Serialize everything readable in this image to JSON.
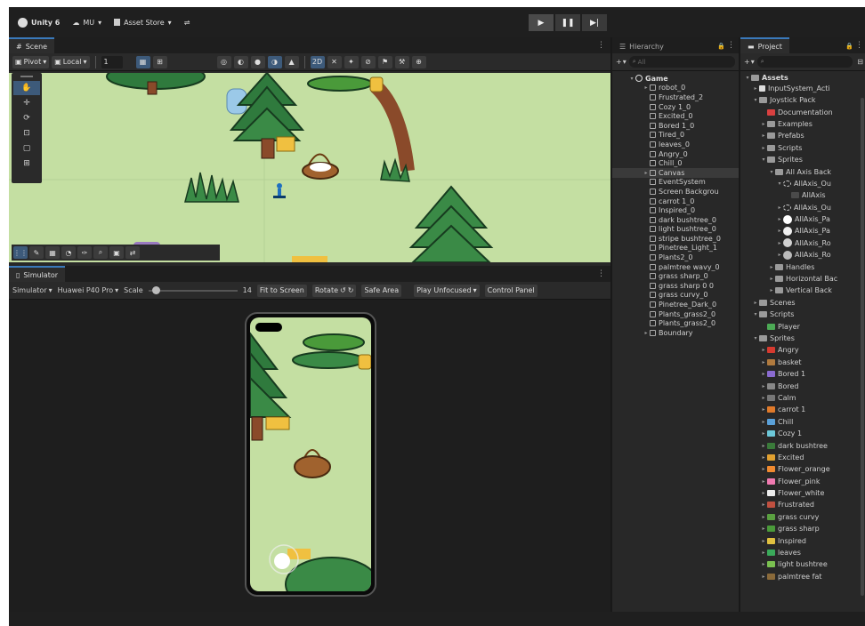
{
  "toolbar": {
    "account": "Unity 6",
    "account_icon": "unity-logo-icon",
    "mu": "MU",
    "asset_store": "Asset Store",
    "play_icon": "play-icon",
    "pause_icon": "pause-icon",
    "step_icon": "step-icon"
  },
  "scene": {
    "tab": "Scene",
    "pivot": "Pivot",
    "local": "Local",
    "snap_value": "1"
  },
  "simulator": {
    "tab": "Simulator",
    "mode": "Simulator",
    "device": "Huawei P40 Pro",
    "scale_label": "Scale",
    "scale_value": "14",
    "fit": "Fit to Screen",
    "rotate": "Rotate",
    "safe_area": "Safe Area",
    "play_mode": "Play Unfocused",
    "control_panel": "Control Panel"
  },
  "hierarchy": {
    "tab": "Hierarchy",
    "search_placeholder": "All",
    "root": "Game",
    "items": [
      {
        "label": "robot_0",
        "arrow": "▸",
        "sel": false
      },
      {
        "label": "Frustrated_2",
        "arrow": "",
        "sel": false
      },
      {
        "label": "Cozy 1_0",
        "arrow": "",
        "sel": false
      },
      {
        "label": "Excited_0",
        "arrow": "",
        "sel": false
      },
      {
        "label": "Bored 1_0",
        "arrow": "",
        "sel": false
      },
      {
        "label": "Tired_0",
        "arrow": "",
        "sel": false
      },
      {
        "label": "leaves_0",
        "arrow": "",
        "sel": false
      },
      {
        "label": "Angry_0",
        "arrow": "",
        "sel": false
      },
      {
        "label": "Chill_0",
        "arrow": "",
        "sel": false
      },
      {
        "label": "Canvas",
        "arrow": "▸",
        "sel": true
      },
      {
        "label": "EventSystem",
        "arrow": "",
        "sel": false
      },
      {
        "label": "Screen Backgrou",
        "arrow": "",
        "sel": false
      },
      {
        "label": "carrot 1_0",
        "arrow": "",
        "sel": false
      },
      {
        "label": "Inspired_0",
        "arrow": "",
        "sel": false
      },
      {
        "label": "dark bushtree_0",
        "arrow": "",
        "sel": false
      },
      {
        "label": "light bushtree_0",
        "arrow": "",
        "sel": false
      },
      {
        "label": "stripe bushtree_0",
        "arrow": "",
        "sel": false
      },
      {
        "label": "Pinetree_Light_1",
        "arrow": "",
        "sel": false
      },
      {
        "label": "Plants2_0",
        "arrow": "",
        "sel": false
      },
      {
        "label": "palmtree wavy_0",
        "arrow": "",
        "sel": false
      },
      {
        "label": "grass sharp_0",
        "arrow": "",
        "sel": false
      },
      {
        "label": "grass sharp 0 0",
        "arrow": "",
        "sel": false
      },
      {
        "label": "grass curvy_0",
        "arrow": "",
        "sel": false
      },
      {
        "label": "Pinetree_Dark_0",
        "arrow": "",
        "sel": false
      },
      {
        "label": "Plants_grass2_0",
        "arrow": "",
        "sel": false
      },
      {
        "label": "Plants_grass2_0",
        "arrow": "",
        "sel": false
      },
      {
        "label": "Boundary",
        "arrow": "▸",
        "sel": false
      }
    ]
  },
  "project": {
    "tab": "Project",
    "root": "Assets",
    "items": [
      {
        "label": "InputSystem_Acti",
        "d": 1,
        "arrow": "▸",
        "kind": "file",
        "color": "#ddd"
      },
      {
        "label": "Joystick Pack",
        "d": 1,
        "arrow": "▾",
        "kind": "folder",
        "color": "#9a9a9a"
      },
      {
        "label": "Documentation",
        "d": 2,
        "arrow": "",
        "kind": "swatch",
        "color": "#d94040"
      },
      {
        "label": "Examples",
        "d": 2,
        "arrow": "▸",
        "kind": "folder",
        "color": "#9a9a9a"
      },
      {
        "label": "Prefabs",
        "d": 2,
        "arrow": "▸",
        "kind": "folder",
        "color": "#9a9a9a"
      },
      {
        "label": "Scripts",
        "d": 2,
        "arrow": "▸",
        "kind": "folder",
        "color": "#9a9a9a"
      },
      {
        "label": "Sprites",
        "d": 2,
        "arrow": "▾",
        "kind": "folder",
        "color": "#9a9a9a"
      },
      {
        "label": "All Axis Back",
        "d": 3,
        "arrow": "▾",
        "kind": "folder",
        "color": "#9a9a9a"
      },
      {
        "label": "AllAxis_Ou",
        "d": 4,
        "arrow": "▾",
        "kind": "ring",
        "color": "#cccccc"
      },
      {
        "label": "AllAxis",
        "d": 5,
        "arrow": "",
        "kind": "swatch",
        "color": "#4a4a4a"
      },
      {
        "label": "AllAxis_Ou",
        "d": 4,
        "arrow": "▸",
        "kind": "ring",
        "color": "#cccccc"
      },
      {
        "label": "AllAxis_Pa",
        "d": 4,
        "arrow": "▸",
        "kind": "dot",
        "color": "#ffffff"
      },
      {
        "label": "AllAxis_Pa",
        "d": 4,
        "arrow": "▸",
        "kind": "dot",
        "color": "#f0f0f0"
      },
      {
        "label": "AllAxis_Ro",
        "d": 4,
        "arrow": "▸",
        "kind": "dot",
        "color": "#d0d0d0"
      },
      {
        "label": "AllAxis_Ro",
        "d": 4,
        "arrow": "▸",
        "kind": "dot",
        "color": "#bbbbbb"
      },
      {
        "label": "Handles",
        "d": 3,
        "arrow": "▸",
        "kind": "folder",
        "color": "#9a9a9a"
      },
      {
        "label": "Horizontal Bac",
        "d": 3,
        "arrow": "▸",
        "kind": "folder",
        "color": "#9a9a9a"
      },
      {
        "label": "Vertical Back",
        "d": 3,
        "arrow": "▸",
        "kind": "folder",
        "color": "#9a9a9a"
      },
      {
        "label": "Scenes",
        "d": 1,
        "arrow": "▸",
        "kind": "folder",
        "color": "#9a9a9a"
      },
      {
        "label": "Scripts",
        "d": 1,
        "arrow": "▾",
        "kind": "folder",
        "color": "#9a9a9a"
      },
      {
        "label": "Player",
        "d": 2,
        "arrow": "",
        "kind": "swatch",
        "color": "#4caa55"
      },
      {
        "label": "Sprites",
        "d": 1,
        "arrow": "▾",
        "kind": "folder",
        "color": "#9a9a9a"
      },
      {
        "label": "Angry",
        "d": 2,
        "arrow": "▸",
        "kind": "swatch",
        "color": "#d63a2f"
      },
      {
        "label": "basket",
        "d": 2,
        "arrow": "▸",
        "kind": "swatch",
        "color": "#b07a3e"
      },
      {
        "label": "Bored 1",
        "d": 2,
        "arrow": "▸",
        "kind": "swatch",
        "color": "#8a6bd0"
      },
      {
        "label": "Bored",
        "d": 2,
        "arrow": "▸",
        "kind": "swatch",
        "color": "#888888"
      },
      {
        "label": "Calm",
        "d": 2,
        "arrow": "▸",
        "kind": "swatch",
        "color": "#777777"
      },
      {
        "label": "carrot 1",
        "d": 2,
        "arrow": "▸",
        "kind": "swatch",
        "color": "#e07a2a"
      },
      {
        "label": "Chill",
        "d": 2,
        "arrow": "▸",
        "kind": "swatch",
        "color": "#5aa0d8"
      },
      {
        "label": "Cozy 1",
        "d": 2,
        "arrow": "▸",
        "kind": "swatch",
        "color": "#6cc7d8"
      },
      {
        "label": "dark bushtree",
        "d": 2,
        "arrow": "▸",
        "kind": "swatch",
        "color": "#3a7a3a"
      },
      {
        "label": "Excited",
        "d": 2,
        "arrow": "▸",
        "kind": "swatch",
        "color": "#e0a030"
      },
      {
        "label": "Flower_orange",
        "d": 2,
        "arrow": "▸",
        "kind": "swatch",
        "color": "#f08a30"
      },
      {
        "label": "Flower_pink",
        "d": 2,
        "arrow": "▸",
        "kind": "swatch",
        "color": "#f07ab0"
      },
      {
        "label": "Flower_white",
        "d": 2,
        "arrow": "▸",
        "kind": "swatch",
        "color": "#eeeeee"
      },
      {
        "label": "Frustrated",
        "d": 2,
        "arrow": "▸",
        "kind": "swatch",
        "color": "#c05040"
      },
      {
        "label": "grass curvy",
        "d": 2,
        "arrow": "▸",
        "kind": "swatch",
        "color": "#5aa040"
      },
      {
        "label": "grass sharp",
        "d": 2,
        "arrow": "▸",
        "kind": "swatch",
        "color": "#4a9a3a"
      },
      {
        "label": "Inspired",
        "d": 2,
        "arrow": "▸",
        "kind": "swatch",
        "color": "#e0c040"
      },
      {
        "label": "leaves",
        "d": 2,
        "arrow": "▸",
        "kind": "swatch",
        "color": "#3aaa5a"
      },
      {
        "label": "light bushtree",
        "d": 2,
        "arrow": "▸",
        "kind": "swatch",
        "color": "#7ac050"
      },
      {
        "label": "palmtree fat",
        "d": 2,
        "arrow": "▸",
        "kind": "swatch",
        "color": "#8a6a3a"
      }
    ]
  },
  "colors": {
    "grass": "#c4dfa2",
    "tree_dark": "#2f7a3d",
    "trunk": "#8a4a2a",
    "basket": "#a0622e",
    "selection": "#3a3a3a"
  }
}
